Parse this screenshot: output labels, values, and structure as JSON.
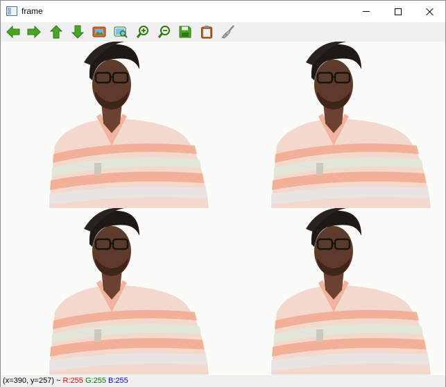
{
  "window": {
    "title": "frame"
  },
  "toolbar": {
    "buttons": [
      {
        "name": "pan-left",
        "icon": "arrow-left-icon",
        "color": "#3a9a1a"
      },
      {
        "name": "pan-right",
        "icon": "arrow-right-icon",
        "color": "#3a9a1a"
      },
      {
        "name": "pan-up",
        "icon": "arrow-up-icon",
        "color": "#3a9a1a"
      },
      {
        "name": "pan-down",
        "icon": "arrow-down-icon",
        "color": "#3a9a1a"
      },
      {
        "name": "zoom-fit",
        "icon": "image-fit-icon",
        "color": "#c0571c"
      },
      {
        "name": "zoom-actual",
        "icon": "image-zoom-icon",
        "color": "#3a9a1a"
      },
      {
        "name": "zoom-in",
        "icon": "zoom-in-icon",
        "color": "#3a9a1a"
      },
      {
        "name": "zoom-out",
        "icon": "zoom-out-icon",
        "color": "#3a9a1a"
      },
      {
        "name": "save-image",
        "icon": "save-icon",
        "color": "#3a9a1a"
      },
      {
        "name": "copy-clipboard",
        "icon": "clipboard-icon",
        "color": "#c0571c"
      },
      {
        "name": "properties",
        "icon": "brush-icon",
        "color": "#9a9a9a"
      }
    ]
  },
  "image": {
    "tiles": 4,
    "content": "webcam-frame"
  },
  "status": {
    "coords": "(x=390, y=257) ~",
    "r": "R:255",
    "g": "G:255",
    "b": "B:255",
    "colors": {
      "r": "#ff0000",
      "g": "#008000",
      "b": "#0000ff"
    }
  }
}
